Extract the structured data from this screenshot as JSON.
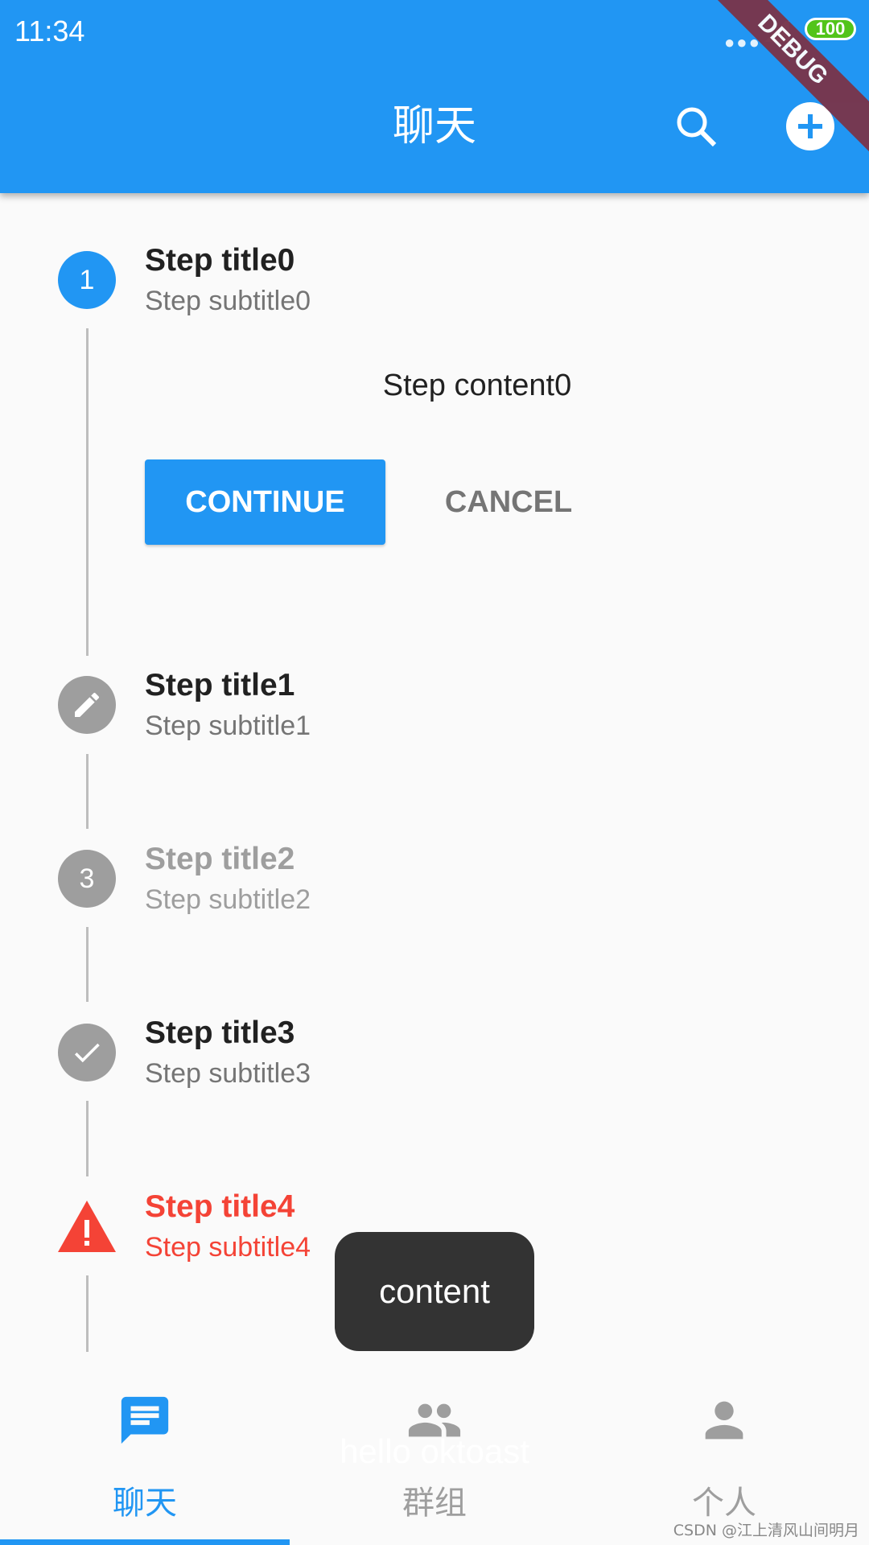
{
  "status_bar": {
    "time": "11:34",
    "battery": "100"
  },
  "debug_banner": "DEBUG",
  "app_bar": {
    "title": "聊天",
    "search_icon": "search-icon",
    "add_icon": "add-circle-icon"
  },
  "colors": {
    "primary": "#2196f3",
    "error": "#f44336",
    "inactive": "#9e9e9e",
    "toast": "#333333"
  },
  "stepper": {
    "steps": [
      {
        "title": "Step title0",
        "subtitle": "Step subtitle0",
        "indicator": "1",
        "state": "active"
      },
      {
        "title": "Step title1",
        "subtitle": "Step subtitle1",
        "indicator": "edit-icon",
        "state": "editing"
      },
      {
        "title": "Step title2",
        "subtitle": "Step subtitle2",
        "indicator": "3",
        "state": "disabled"
      },
      {
        "title": "Step title3",
        "subtitle": "Step subtitle3",
        "indicator": "check-icon",
        "state": "complete"
      },
      {
        "title": "Step title4",
        "subtitle": "Step subtitle4",
        "indicator": "warning-icon",
        "state": "error"
      }
    ],
    "content": "Step content0",
    "continue_label": "CONTINUE",
    "cancel_label": "CANCEL"
  },
  "toast": {
    "text": "content",
    "faint_text": "hello oktoast"
  },
  "bottom_nav": {
    "items": [
      {
        "label": "聊天",
        "icon": "chat-icon",
        "active": true
      },
      {
        "label": "群组",
        "icon": "group-icon",
        "active": false
      },
      {
        "label": "个人",
        "icon": "person-icon",
        "active": false
      }
    ]
  },
  "watermark": "CSDN @江上清风山间明月"
}
